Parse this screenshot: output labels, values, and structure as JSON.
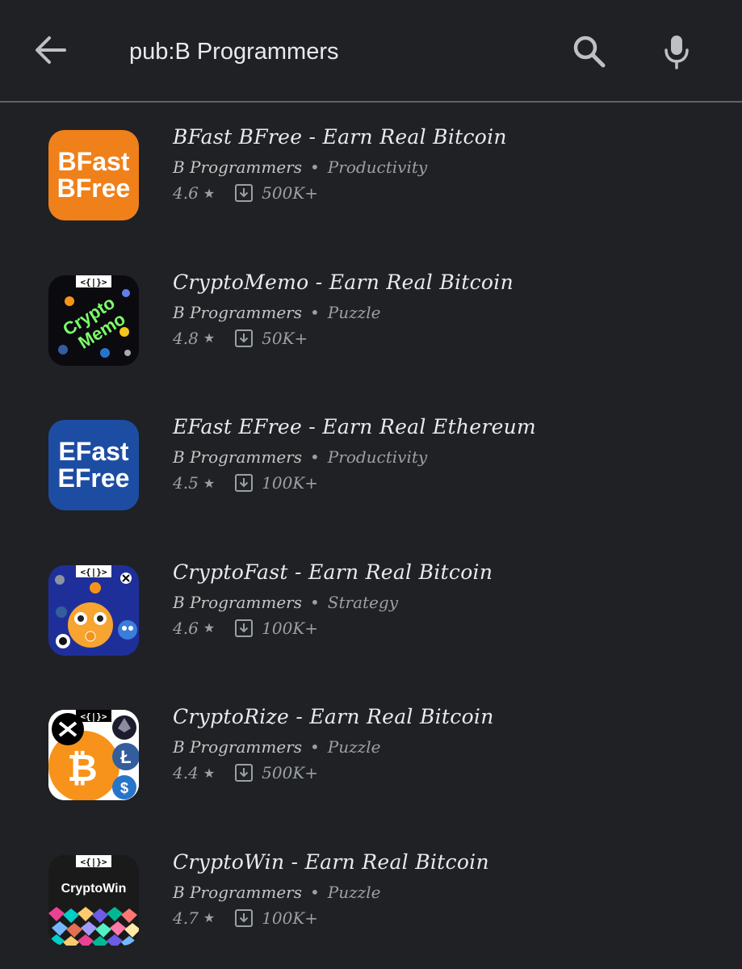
{
  "search": {
    "query": "pub:B Programmers"
  },
  "icons": {
    "back": "arrow-back-icon",
    "search": "search-icon",
    "mic": "microphone-icon",
    "download": "download-icon",
    "star": "star-icon"
  },
  "colors": {
    "background": "#202124",
    "text_primary": "#e8eaed",
    "text_secondary": "#9aa0a6",
    "bfast_orange": "#f0801a",
    "efast_blue": "#1d4da3"
  },
  "apps": [
    {
      "title": "BFast BFree - Earn Real Bitcoin",
      "developer": "B Programmers",
      "category": "Productivity",
      "rating": "4.6",
      "star": "★",
      "downloads": "500K+",
      "icon_text_1": "BFast",
      "icon_text_2": "BFree"
    },
    {
      "title": "CryptoMemo - Earn Real Bitcoin",
      "developer": "B Programmers",
      "category": "Puzzle",
      "rating": "4.8",
      "star": "★",
      "downloads": "50K+",
      "icon_text_1": "Crypto",
      "icon_text_2": "Memo",
      "icon_tag": "<{|}>"
    },
    {
      "title": "EFast EFree - Earn Real Ethereum",
      "developer": "B Programmers",
      "category": "Productivity",
      "rating": "4.5",
      "star": "★",
      "downloads": "100K+",
      "icon_text_1": "EFast",
      "icon_text_2": "EFree"
    },
    {
      "title": "CryptoFast - Earn Real Bitcoin",
      "developer": "B Programmers",
      "category": "Strategy",
      "rating": "4.6",
      "star": "★",
      "downloads": "100K+",
      "icon_tag": "<{|}>"
    },
    {
      "title": "CryptoRize - Earn Real Bitcoin",
      "developer": "B Programmers",
      "category": "Puzzle",
      "rating": "4.4",
      "star": "★",
      "downloads": "500K+",
      "icon_tag": "<{|}>"
    },
    {
      "title": "CryptoWin - Earn Real Bitcoin",
      "developer": "B Programmers",
      "category": "Puzzle",
      "rating": "4.7",
      "star": "★",
      "downloads": "100K+",
      "icon_tag": "<{|}>",
      "icon_text_1": "CryptoWin"
    }
  ]
}
